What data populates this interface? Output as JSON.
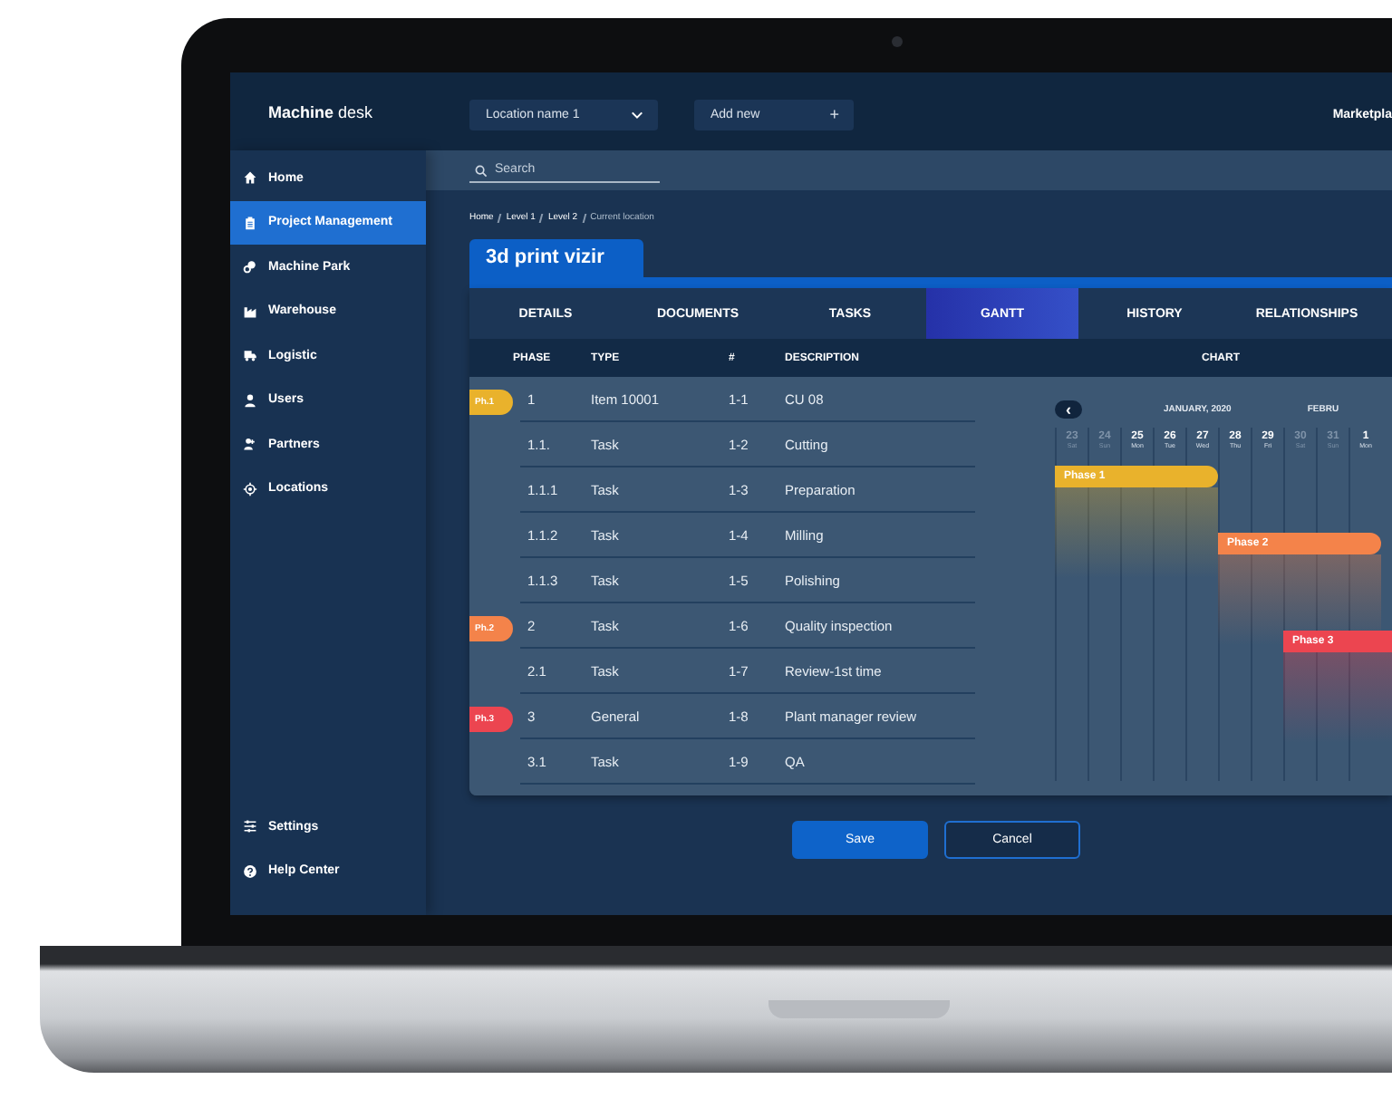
{
  "header": {
    "brand_bold": "Machine",
    "brand_rest": "desk",
    "location_select": "Location name 1",
    "add_button": "Add new",
    "add_icon": "+",
    "right_link": "Marketpla"
  },
  "sidebar": {
    "items": [
      {
        "label": "Home",
        "selected": false
      },
      {
        "label": "Project Management",
        "selected": true
      },
      {
        "label": "Machine Park",
        "selected": false
      },
      {
        "label": "Warehouse",
        "selected": false
      },
      {
        "label": "Logistic",
        "selected": false
      },
      {
        "label": "Users",
        "selected": false
      },
      {
        "label": "Partners",
        "selected": false
      },
      {
        "label": "Locations",
        "selected": false
      }
    ],
    "bottom_items": [
      {
        "label": "Settings",
        "selected": false
      },
      {
        "label": "Help Center",
        "selected": false
      }
    ]
  },
  "search": {
    "placeholder": "Search"
  },
  "breadcrumb": [
    "Home",
    "Level 1",
    "Level 2",
    "Current location"
  ],
  "project_title": "3d print vizir",
  "tabs": [
    {
      "label": "DETAILS",
      "selected": false
    },
    {
      "label": "DOCUMENTS",
      "selected": false
    },
    {
      "label": "TASKS",
      "selected": false
    },
    {
      "label": "GANTT",
      "selected": true
    },
    {
      "label": "HISTORY",
      "selected": false
    },
    {
      "label": "RELATIONSHIPS",
      "selected": false
    }
  ],
  "table": {
    "columns": [
      "PHASE",
      "TYPE",
      "#",
      "DESCRIPTION"
    ],
    "rows": [
      {
        "tag": {
          "label": "Ph.1",
          "color": "#e9b22c"
        },
        "phase": "1",
        "type": "Item 10001",
        "number": "1-1",
        "description": "CU 08"
      },
      {
        "phase": "1.1.",
        "type": "Task",
        "number": "1-2",
        "description": "Cutting"
      },
      {
        "phase": "1.1.1",
        "type": "Task",
        "number": "1-3",
        "description": "Preparation"
      },
      {
        "phase": "1.1.2",
        "type": "Task",
        "number": "1-4",
        "description": "Milling"
      },
      {
        "phase": "1.1.3",
        "type": "Task",
        "number": "1-5",
        "description": "Polishing"
      },
      {
        "tag": {
          "label": "Ph.2",
          "color": "#f4834a"
        },
        "phase": "2",
        "type": "Task",
        "number": "1-6",
        "description": "Quality inspection"
      },
      {
        "phase": "2.1",
        "type": "Task",
        "number": "1-7",
        "description": "Review-1st time"
      },
      {
        "tag": {
          "label": "Ph.3",
          "color": "#ec4550"
        },
        "phase": "3",
        "type": "General",
        "number": "1-8",
        "description": "Plant manager review"
      },
      {
        "phase": "3.1",
        "type": "Task",
        "number": "1-9",
        "description": "QA"
      }
    ]
  },
  "chart": {
    "heading": "CHART",
    "prev_icon": "‹",
    "month": "JANUARY, 2020",
    "next_month": "FEBRU",
    "days": [
      {
        "day": "23",
        "weekday": "Sat",
        "weekend": true
      },
      {
        "day": "24",
        "weekday": "Sun",
        "weekend": true
      },
      {
        "day": "25",
        "weekday": "Mon",
        "weekend": false
      },
      {
        "day": "26",
        "weekday": "Tue",
        "weekend": false
      },
      {
        "day": "27",
        "weekday": "Wed",
        "weekend": false
      },
      {
        "day": "28",
        "weekday": "Thu",
        "weekend": false
      },
      {
        "day": "29",
        "weekday": "Fri",
        "weekend": false
      },
      {
        "day": "30",
        "weekday": "Sat",
        "weekend": true
      },
      {
        "day": "31",
        "weekday": "Sun",
        "weekend": true
      },
      {
        "day": "1",
        "weekday": "Mon",
        "weekend": false
      }
    ],
    "bars": [
      {
        "label": "Phase 1",
        "color": "#e9b22c"
      },
      {
        "label": "Phase 2",
        "color": "#f4834a"
      },
      {
        "label": "Phase 3",
        "color": "#ec4550"
      }
    ]
  },
  "buttons": {
    "save": "Save",
    "cancel": "Cancel"
  }
}
